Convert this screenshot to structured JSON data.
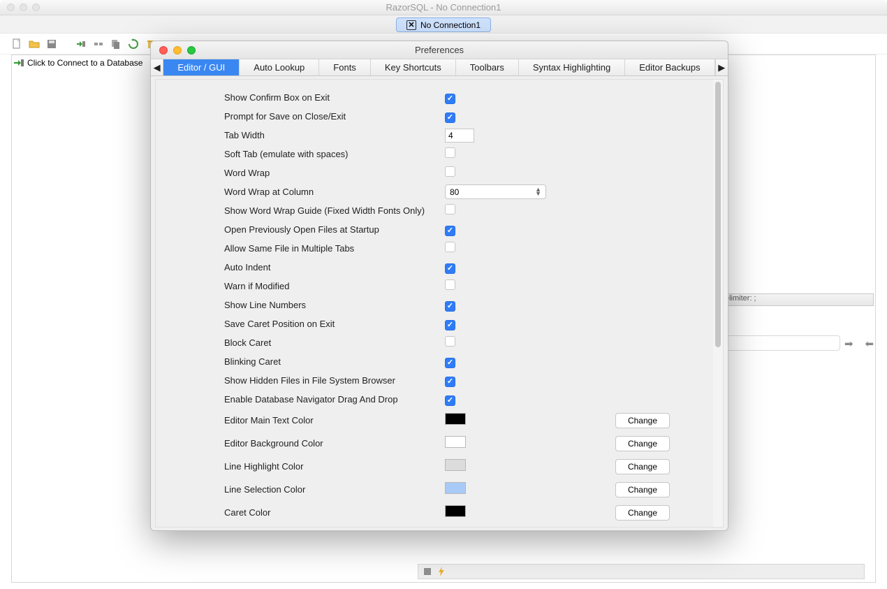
{
  "app": {
    "window_title": "RazorSQL - No Connection1",
    "connection_tab": "No Connection1",
    "sidebar_connect_label": "Click to Connect to a Database",
    "right_panel": {
      "delimiter_label": "elimiter: ;"
    }
  },
  "preferences": {
    "title": "Preferences",
    "tabs": [
      "Editor / GUI",
      "Auto Lookup",
      "Fonts",
      "Key Shortcuts",
      "Toolbars",
      "Syntax Highlighting",
      "Editor Backups"
    ],
    "active_tab": "Editor / GUI",
    "change_button": "Change",
    "fields": {
      "confirm_exit": {
        "label": "Show Confirm Box on Exit",
        "checked": true
      },
      "prompt_save": {
        "label": "Prompt for Save on Close/Exit",
        "checked": true
      },
      "tab_width": {
        "label": "Tab Width",
        "value": "4"
      },
      "soft_tab": {
        "label": "Soft Tab (emulate with spaces)",
        "checked": false
      },
      "word_wrap": {
        "label": "Word Wrap",
        "checked": false
      },
      "wrap_col": {
        "label": "Word Wrap at Column",
        "value": "80"
      },
      "wrap_guide": {
        "label": "Show Word Wrap Guide (Fixed Width Fonts Only)",
        "checked": false
      },
      "open_prev": {
        "label": "Open Previously Open Files at Startup",
        "checked": true
      },
      "same_file": {
        "label": "Allow Same File in Multiple Tabs",
        "checked": false
      },
      "auto_indent": {
        "label": "Auto Indent",
        "checked": true
      },
      "warn_mod": {
        "label": "Warn if Modified",
        "checked": false
      },
      "line_num": {
        "label": "Show Line Numbers",
        "checked": true
      },
      "caret_pos": {
        "label": "Save Caret Position on Exit",
        "checked": true
      },
      "block_caret": {
        "label": "Block Caret",
        "checked": false
      },
      "blink_caret": {
        "label": "Blinking Caret",
        "checked": true
      },
      "hidden_files": {
        "label": "Show Hidden Files in File System Browser",
        "checked": true
      },
      "drag_drop": {
        "label": "Enable Database Navigator Drag And Drop",
        "checked": true
      },
      "main_text_color": {
        "label": "Editor Main Text Color",
        "color": "#000000"
      },
      "bg_color": {
        "label": "Editor Background Color",
        "color": "#ffffff"
      },
      "hl_color": {
        "label": "Line Highlight Color",
        "color": "#dcdcdc"
      },
      "sel_color": {
        "label": "Line Selection Color",
        "color": "#a8caf6"
      },
      "caret_color": {
        "label": "Caret Color",
        "color": "#000000"
      }
    }
  }
}
